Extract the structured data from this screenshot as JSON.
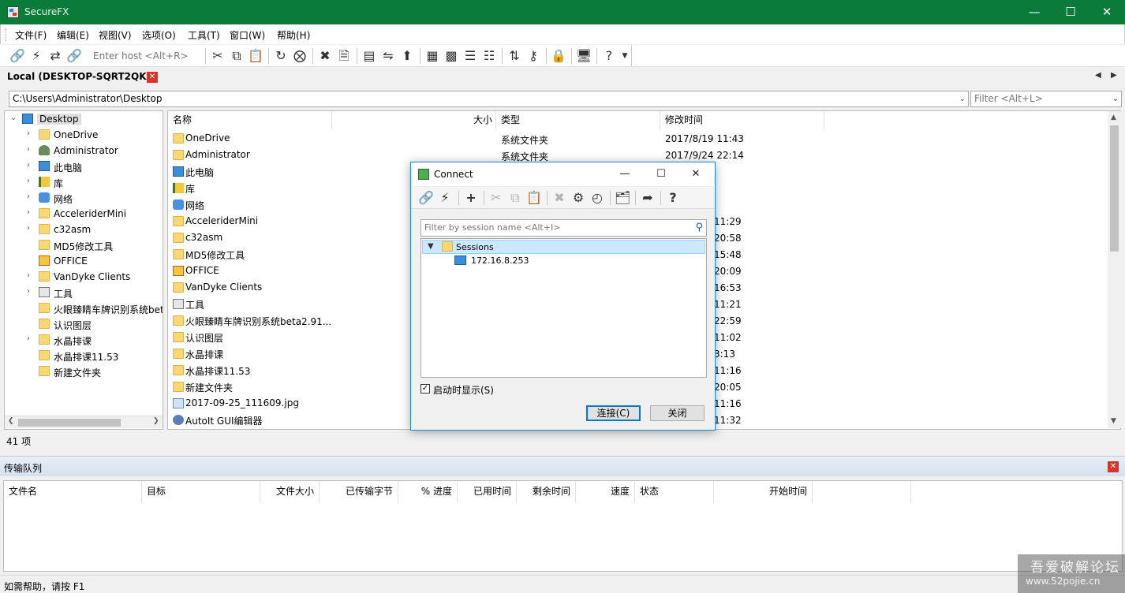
{
  "window": {
    "title": "SecureFX"
  },
  "menu": [
    "文件(F)",
    "编辑(E)",
    "视图(V)",
    "选项(O)",
    "工具(T)",
    "窗口(W)",
    "帮助(H)"
  ],
  "toolbar": {
    "host_placeholder": "Enter host <Alt+R>"
  },
  "tab": {
    "label": "Local (DESKTOP-SQRT2QK)"
  },
  "path": {
    "value": "C:\\Users\\Administrator\\Desktop",
    "filter_placeholder": "Filter <Alt+L>"
  },
  "tree": [
    {
      "label": "Desktop",
      "icon": "desktop-icon"
    },
    {
      "label": "OneDrive",
      "icon": "folder-icon"
    },
    {
      "label": "Administrator",
      "icon": "user-icon"
    },
    {
      "label": "此电脑",
      "icon": "computer-icon"
    },
    {
      "label": "库",
      "icon": "library-icon"
    },
    {
      "label": "网络",
      "icon": "network-icon"
    },
    {
      "label": "AcceleriderMini",
      "icon": "folder-icon"
    },
    {
      "label": "c32asm",
      "icon": "folder-icon"
    },
    {
      "label": "MD5修改工具",
      "icon": "folder-icon"
    },
    {
      "label": "OFFICE",
      "icon": "office-icon"
    },
    {
      "label": "VanDyke Clients",
      "icon": "folder-icon"
    },
    {
      "label": "工具",
      "icon": "tools-icon"
    },
    {
      "label": "火眼臻睛车牌识别系统bet",
      "icon": "folder-icon"
    },
    {
      "label": "认识图层",
      "icon": "folder-icon"
    },
    {
      "label": "水晶排课",
      "icon": "folder-icon"
    },
    {
      "label": "水晶排课11.53",
      "icon": "folder-icon"
    },
    {
      "label": "新建文件夹",
      "icon": "folder-icon"
    }
  ],
  "columns": {
    "name": "名称",
    "size": "大小",
    "type": "类型",
    "mtime": "修改时间"
  },
  "files": [
    {
      "name": "OneDrive",
      "type": "系统文件夹",
      "mtime": "2017/8/19 11:43",
      "icon": "folder-icon"
    },
    {
      "name": "Administrator",
      "type": "系统文件夹",
      "mtime": "2017/9/24 22:14",
      "icon": "folder-icon"
    },
    {
      "name": "此电脑",
      "type": "",
      "mtime": "",
      "icon": "computer-icon"
    },
    {
      "name": "库",
      "type": "",
      "mtime": "",
      "icon": "library-icon"
    },
    {
      "name": "网络",
      "type": "",
      "mtime": "",
      "icon": "network-icon"
    },
    {
      "name": "AcceleriderMini",
      "type": "",
      "mtime": "11:29",
      "icon": "folder-icon"
    },
    {
      "name": "c32asm",
      "type": "",
      "mtime": "20:58",
      "icon": "folder-icon"
    },
    {
      "name": "MD5修改工具",
      "type": "",
      "mtime": "15:48",
      "icon": "folder-icon"
    },
    {
      "name": "OFFICE",
      "type": "",
      "mtime": "20:09",
      "icon": "office-icon"
    },
    {
      "name": "VanDyke Clients",
      "type": "",
      "mtime": "16:53",
      "icon": "folder-icon"
    },
    {
      "name": "工具",
      "type": "",
      "mtime": "11:21",
      "icon": "tools-icon"
    },
    {
      "name": "火眼臻睛车牌识别系统beta2.91...",
      "type": "",
      "mtime": "22:59",
      "icon": "folder-icon"
    },
    {
      "name": "认识图层",
      "type": "",
      "mtime": "11:02",
      "icon": "folder-icon"
    },
    {
      "name": "水晶排课",
      "type": "",
      "mtime": "3:13",
      "icon": "folder-icon"
    },
    {
      "name": "水晶排课11.53",
      "type": "",
      "mtime": "11:16",
      "icon": "folder-icon"
    },
    {
      "name": "新建文件夹",
      "type": "",
      "mtime": "20:05",
      "icon": "folder-icon"
    },
    {
      "name": "2017-09-25_111609.jpg",
      "type": "",
      "mtime": "11:16",
      "icon": "image-icon"
    },
    {
      "name": "AutoIt GUI编辑器",
      "type": "",
      "mtime": "11:32",
      "icon": "autoit-icon"
    }
  ],
  "item_count": "41 项",
  "transfer": {
    "title": "传输队列",
    "columns": [
      "文件名",
      "目标",
      "文件大小",
      "已传输字节",
      "% 进度",
      "已用时间",
      "剩余时间",
      "速度",
      "状态",
      "开始时间"
    ]
  },
  "status": "如需帮助，请按 F1",
  "watermark": {
    "line1": "吾爱破解论坛",
    "line2": "www.52pojie.cn"
  },
  "dialog": {
    "title": "Connect",
    "filter_placeholder": "Filter by session name <Alt+I>",
    "folder": "Sessions",
    "session": "172.16.8.253",
    "startup_label": "启动时显示(S)",
    "connect_label": "连接(C)",
    "close_label": "关闭"
  }
}
